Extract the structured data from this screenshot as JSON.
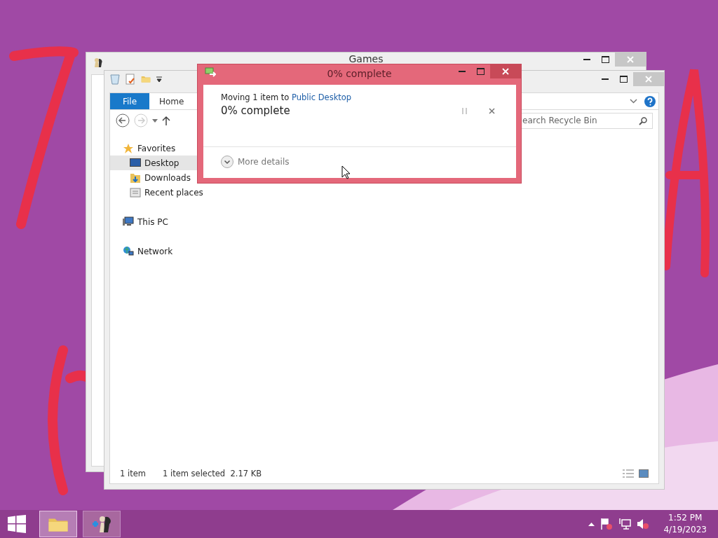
{
  "back_window": {
    "title": "Games"
  },
  "explorer": {
    "ribbon_tabs": [
      {
        "label": "File",
        "kind": "file_menu"
      },
      {
        "label": "Home",
        "kind": "tab"
      }
    ],
    "search": {
      "placeholder": "earch Recycle Bin"
    },
    "nav": [
      {
        "label": "Favorites",
        "selected": false,
        "children": [
          {
            "label": "Desktop",
            "selected": true
          },
          {
            "label": "Downloads",
            "selected": false
          },
          {
            "label": "Recent places",
            "selected": false
          }
        ]
      },
      {
        "label": "This PC",
        "selected": false
      },
      {
        "label": "Network",
        "selected": false
      }
    ],
    "status_bar": {
      "count": "1 item",
      "selection": "1 item selected  2.17 KB"
    }
  },
  "dialog": {
    "title": "0% complete",
    "message_prefix": "Moving 1 item to ",
    "destination_link": "Public Desktop",
    "progress_text": "0% complete",
    "more_details": "More details"
  },
  "taskbar": {
    "buttons": [
      {
        "kind": "explorer",
        "selected": true
      },
      {
        "kind": "games",
        "selected": false
      }
    ],
    "clock": {
      "time": "1:52 PM",
      "date": "4/19/2023"
    }
  }
}
